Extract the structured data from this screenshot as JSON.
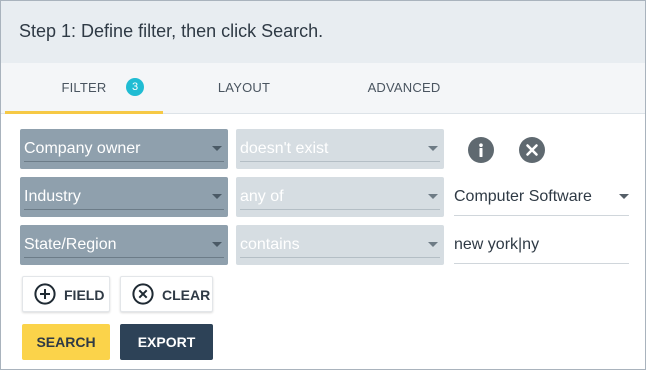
{
  "header": {
    "title": "Step 1: Define filter, then click Search."
  },
  "tabs": [
    {
      "label": "FILTER",
      "badge": "3",
      "active": true
    },
    {
      "label": "LAYOUT",
      "active": false
    },
    {
      "label": "ADVANCED",
      "active": false
    }
  ],
  "filters": [
    {
      "field": "Company owner",
      "operator": "doesn't exist",
      "value": ""
    },
    {
      "field": "Industry",
      "operator": "any of",
      "value": "Computer Software"
    },
    {
      "field": "State/Region",
      "operator": "contains",
      "value": "new york|ny"
    }
  ],
  "icons": {
    "info": "info-icon",
    "remove": "close-circle-icon",
    "add": "plus-circle-icon",
    "clear": "x-circle-icon",
    "dropdown": "caret-down-icon"
  },
  "buttons": {
    "field": "FIELD",
    "clear": "CLEAR",
    "search": "SEARCH",
    "export": "EXPORT"
  },
  "colors": {
    "accent": "#f6c945",
    "badge": "#20bcd3",
    "field_select": "#8fa0ad",
    "operator_select": "#d6dde2",
    "search": "#fbd34a",
    "export": "#2d4257"
  }
}
